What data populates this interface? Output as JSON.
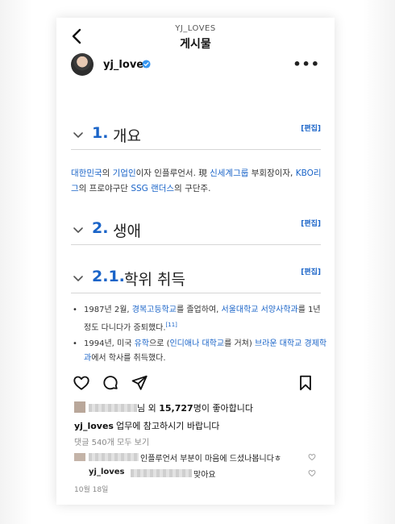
{
  "header": {
    "username": "YJ_LOVES",
    "title": "게시물"
  },
  "post": {
    "author": "yj_loves",
    "more_label": "•••"
  },
  "article": {
    "sections": [
      {
        "num": "1.",
        "title": "개요",
        "edit": "[편집]"
      },
      {
        "num": "2.",
        "title": "생애",
        "edit": "[편집]"
      },
      {
        "num": "2.1.",
        "title": "학위 취득",
        "edit": "[편집]"
      }
    ],
    "intro": {
      "l1": "대한민국",
      "t1": "의 ",
      "l2": "기업인",
      "t2": "이자 인플루언서. 現 ",
      "l3": "신세계그룹",
      "t3": " 부회장이자, ",
      "l4": "KBO리그",
      "t4": "의 프로야구단 ",
      "l5": "SSG 랜더스",
      "t5": "의 구단주."
    },
    "bullet1": {
      "t1": "1987년 2월, ",
      "l1": "경복고등학교",
      "t2": "를 졸업하여, ",
      "l2": "서울대학교 서양사학과",
      "t3": "를 1년 정도 다니다가 중퇴했다.",
      "ref": "[11]"
    },
    "bullet2": {
      "t1": "1994년, 미국 ",
      "l1": "유학",
      "t2": "으로 (",
      "l2": "인디애나 대학교",
      "t3": "를 거쳐) ",
      "l3": "브라운 대학교 경제학과",
      "t4": "에서 학사를 취득했다."
    },
    "bullet_dot": "•"
  },
  "likes": {
    "suffix_char": "님",
    "prefix": " 외 ",
    "count": "15,727",
    "suffix": "명이 좋아합니다"
  },
  "caption": {
    "author": "yj_loves",
    "text": "업무에 참고하시기 바랍니다"
  },
  "view_comments": "댓글 540개 모두 보기",
  "comments": [
    {
      "text": "인플루언서 부분이 마음에 드셨나봅니다ㅎ"
    },
    {
      "author": "yj_loves",
      "text": "맞아요"
    }
  ],
  "date": "10월 18일",
  "colors": {
    "link": "#1a64c8",
    "verified": "#3897f0"
  }
}
